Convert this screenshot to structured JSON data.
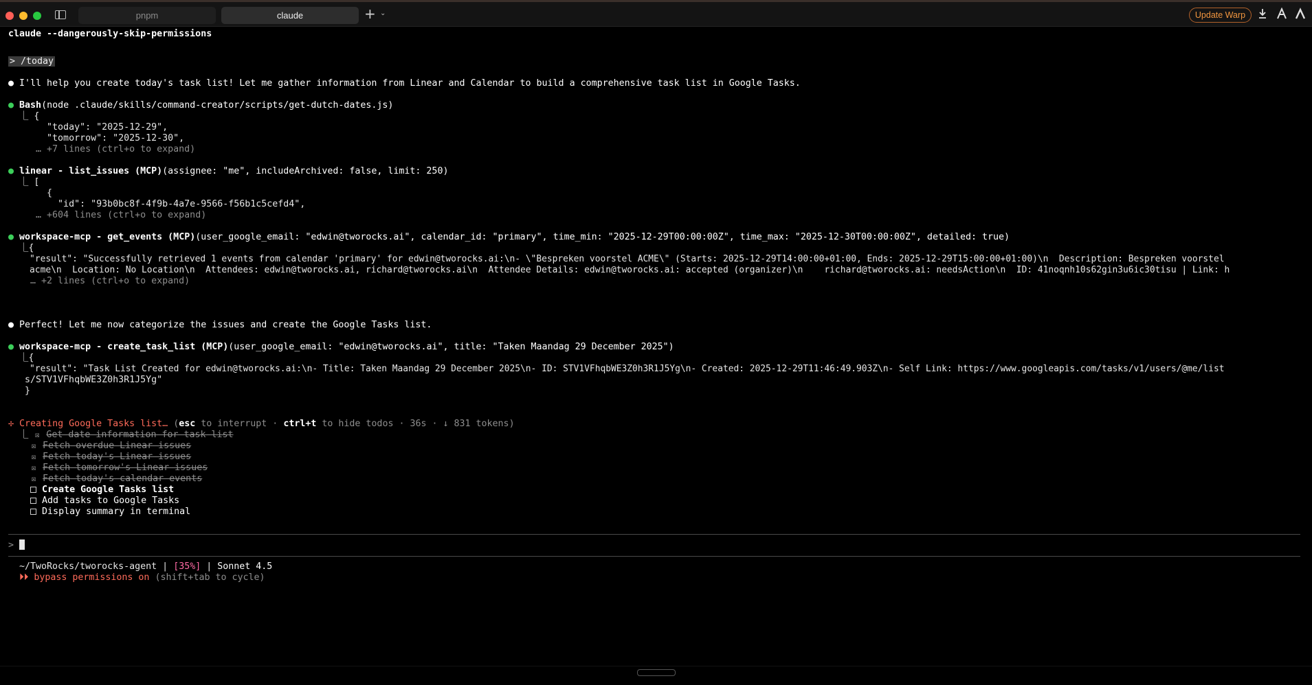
{
  "window": {
    "tabs": [
      {
        "label": "pnpm",
        "active": false
      },
      {
        "label": "claude",
        "active": true
      }
    ],
    "update_button": "Update Warp",
    "icons": [
      "sidebar-toggle-icon",
      "plus-icon",
      "chevron-down-icon",
      "download-icon",
      "warp-logo-icon",
      "agent-icon"
    ]
  },
  "terminal": {
    "command": "claude --dangerously-skip-permissions",
    "prompt_input": "> /today",
    "intro": "I'll help you create today's task list! Let me gather information from Linear and Calendar to build a comprehensive task list in Google Tasks.",
    "bash": {
      "tool": "Bash",
      "args": "(node .claude/skills/command-creator/scripts/get-dutch-dates.js)",
      "out": [
        "{",
        "  \"today\": \"2025-12-29\",",
        "  \"tomorrow\": \"2025-12-30\","
      ],
      "more": "… +7 lines (ctrl+o to expand)"
    },
    "linear": {
      "tool": "linear - list_issues (MCP)",
      "args": "(assignee: \"me\", includeArchived: false, limit: 250)",
      "out": [
        "[",
        "  {",
        "    \"id\": \"93b0bc8f-4f9b-4a7e-9566-f56b1c5cefd4\","
      ],
      "more": "… +604 lines (ctrl+o to expand)"
    },
    "events": {
      "tool": "workspace-mcp - get_events (MCP)",
      "args": "(user_google_email: \"edwin@tworocks.ai\", calendar_id: \"primary\", time_min: \"2025-12-29T00:00:00Z\", time_max: \"2025-12-30T00:00:00Z\", detailed: true)",
      "out": [
        "{",
        "    \"result\": \"Successfully retrieved 1 events from calendar 'primary' for edwin@tworocks.ai:\\n- \\\"Bespreken voorstel ACME\\\" (Starts: 2025-12-29T14:00:00+01:00, Ends: 2025-12-29T15:00:00+01:00)\\n  Description: Bespreken voorstel",
        "    acme\\n  Location: No Location\\n  Attendees: edwin@tworocks.ai, richard@tworocks.ai\\n  Attendee Details: edwin@tworocks.ai: accepted (organizer)\\n    richard@tworocks.ai: needsAction\\n  ID: 41noqnh10s62gin3u6ic30tisu | Link: h"
      ],
      "more": "… +2 lines (ctrl+o to expand)"
    },
    "perfect": "Perfect! Let me now categorize the issues and create the Google Tasks list.",
    "create": {
      "tool": "workspace-mcp - create_task_list (MCP)",
      "args": "(user_google_email: \"edwin@tworocks.ai\", title: \"Taken Maandag 29 December 2025\")",
      "out": [
        "{",
        "    \"result\": \"Task List Created for edwin@tworocks.ai:\\n- Title: Taken Maandag 29 December 2025\\n- ID: STV1VFhqbWE3Z0h3R1J5Yg\\n- Created: 2025-12-29T11:46:49.903Z\\n- Self Link: https://www.googleapis.com/tasks/v1/users/@me/list",
        "   s/STV1VFhqbWE3Z0h3R1J5Yg\"",
        "   }"
      ]
    },
    "status": {
      "spinner": "✢",
      "label": "Creating Google Tasks list…",
      "paren_open": " (",
      "esc": "esc",
      "interrupt": " to interrupt · ",
      "ctrl_t": "ctrl+t",
      "hide": " to hide todos · 36s · ↓ 831 tokens)"
    },
    "todos": [
      {
        "text": "Get date information for task list",
        "done": true
      },
      {
        "text": "Fetch overdue Linear issues",
        "done": true
      },
      {
        "text": "Fetch today's Linear issues",
        "done": true
      },
      {
        "text": "Fetch tomorrow's Linear issues",
        "done": true
      },
      {
        "text": "Fetch today's calendar events",
        "done": true
      },
      {
        "text": "Create Google Tasks list",
        "done": false,
        "active": true
      },
      {
        "text": "Add tasks to Google Tasks",
        "done": false
      },
      {
        "text": "Display summary in terminal",
        "done": false
      }
    ],
    "input_prompt": ">",
    "footer": {
      "path": "~/TwoRocks/tworocks-agent",
      "sep1": " | ",
      "context": "[35%]",
      "sep2": " | ",
      "model": "Sonnet 4.5",
      "bypass": "⏵⏵ bypass permissions on",
      "bypass_hint": " (shift+tab to cycle)"
    }
  },
  "colors": {
    "accent_green": "#3ccf5a",
    "status_red": "#ff6b5a",
    "context_pink": "#ff6aa5",
    "update_orange": "#f0953f"
  }
}
